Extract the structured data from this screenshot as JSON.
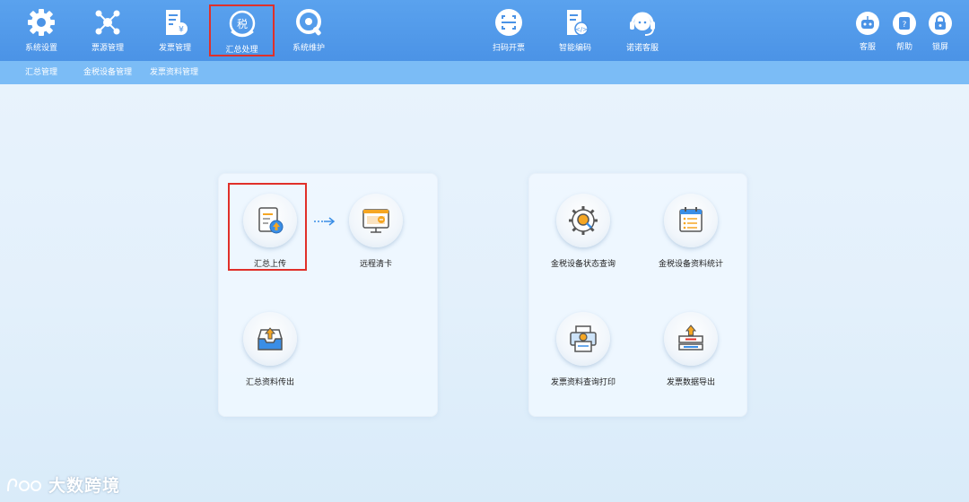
{
  "toolbar": {
    "items": [
      {
        "label": "系统设置",
        "icon": "gear-icon"
      },
      {
        "label": "票源管理",
        "icon": "network-icon"
      },
      {
        "label": "发票管理",
        "icon": "invoice-icon"
      },
      {
        "label": "汇总处理",
        "icon": "tax-summary-icon"
      },
      {
        "label": "系统维护",
        "icon": "wrench-icon"
      },
      {
        "label": "扫码开票",
        "icon": "scan-icon"
      },
      {
        "label": "智能编码",
        "icon": "smart-code-icon"
      },
      {
        "label": "诺诺客服",
        "icon": "headset-icon"
      }
    ],
    "right_items": [
      {
        "label": "客服",
        "icon": "robot-icon"
      },
      {
        "label": "帮助",
        "icon": "help-icon"
      },
      {
        "label": "锁屏",
        "icon": "lock-icon"
      }
    ],
    "active": "汇总处理"
  },
  "subnav": {
    "items": [
      "汇总管理",
      "金税设备管理",
      "发票资料管理"
    ]
  },
  "left_panel": {
    "functions": [
      {
        "label": "汇总上传",
        "icon": "summary-upload-icon",
        "highlighted": true
      },
      {
        "label": "远程清卡",
        "icon": "remote-clear-card-icon"
      },
      {
        "label": "汇总资料传出",
        "icon": "summary-export-icon"
      }
    ]
  },
  "right_panel": {
    "functions": [
      {
        "label": "金税设备状态查询",
        "icon": "device-status-query-icon"
      },
      {
        "label": "金税设备资料统计",
        "icon": "device-data-stats-icon"
      },
      {
        "label": "发票资料查询打印",
        "icon": "print-query-icon"
      },
      {
        "label": "发票数据导出",
        "icon": "data-export-icon"
      }
    ]
  },
  "watermark": {
    "text": "大数跨境"
  },
  "colors": {
    "toolbar": "#4b93e6",
    "subnav": "#7bbcf6",
    "highlight": "#e0302a",
    "accent_orange": "#f5a623",
    "accent_blue": "#3a8ee6"
  }
}
